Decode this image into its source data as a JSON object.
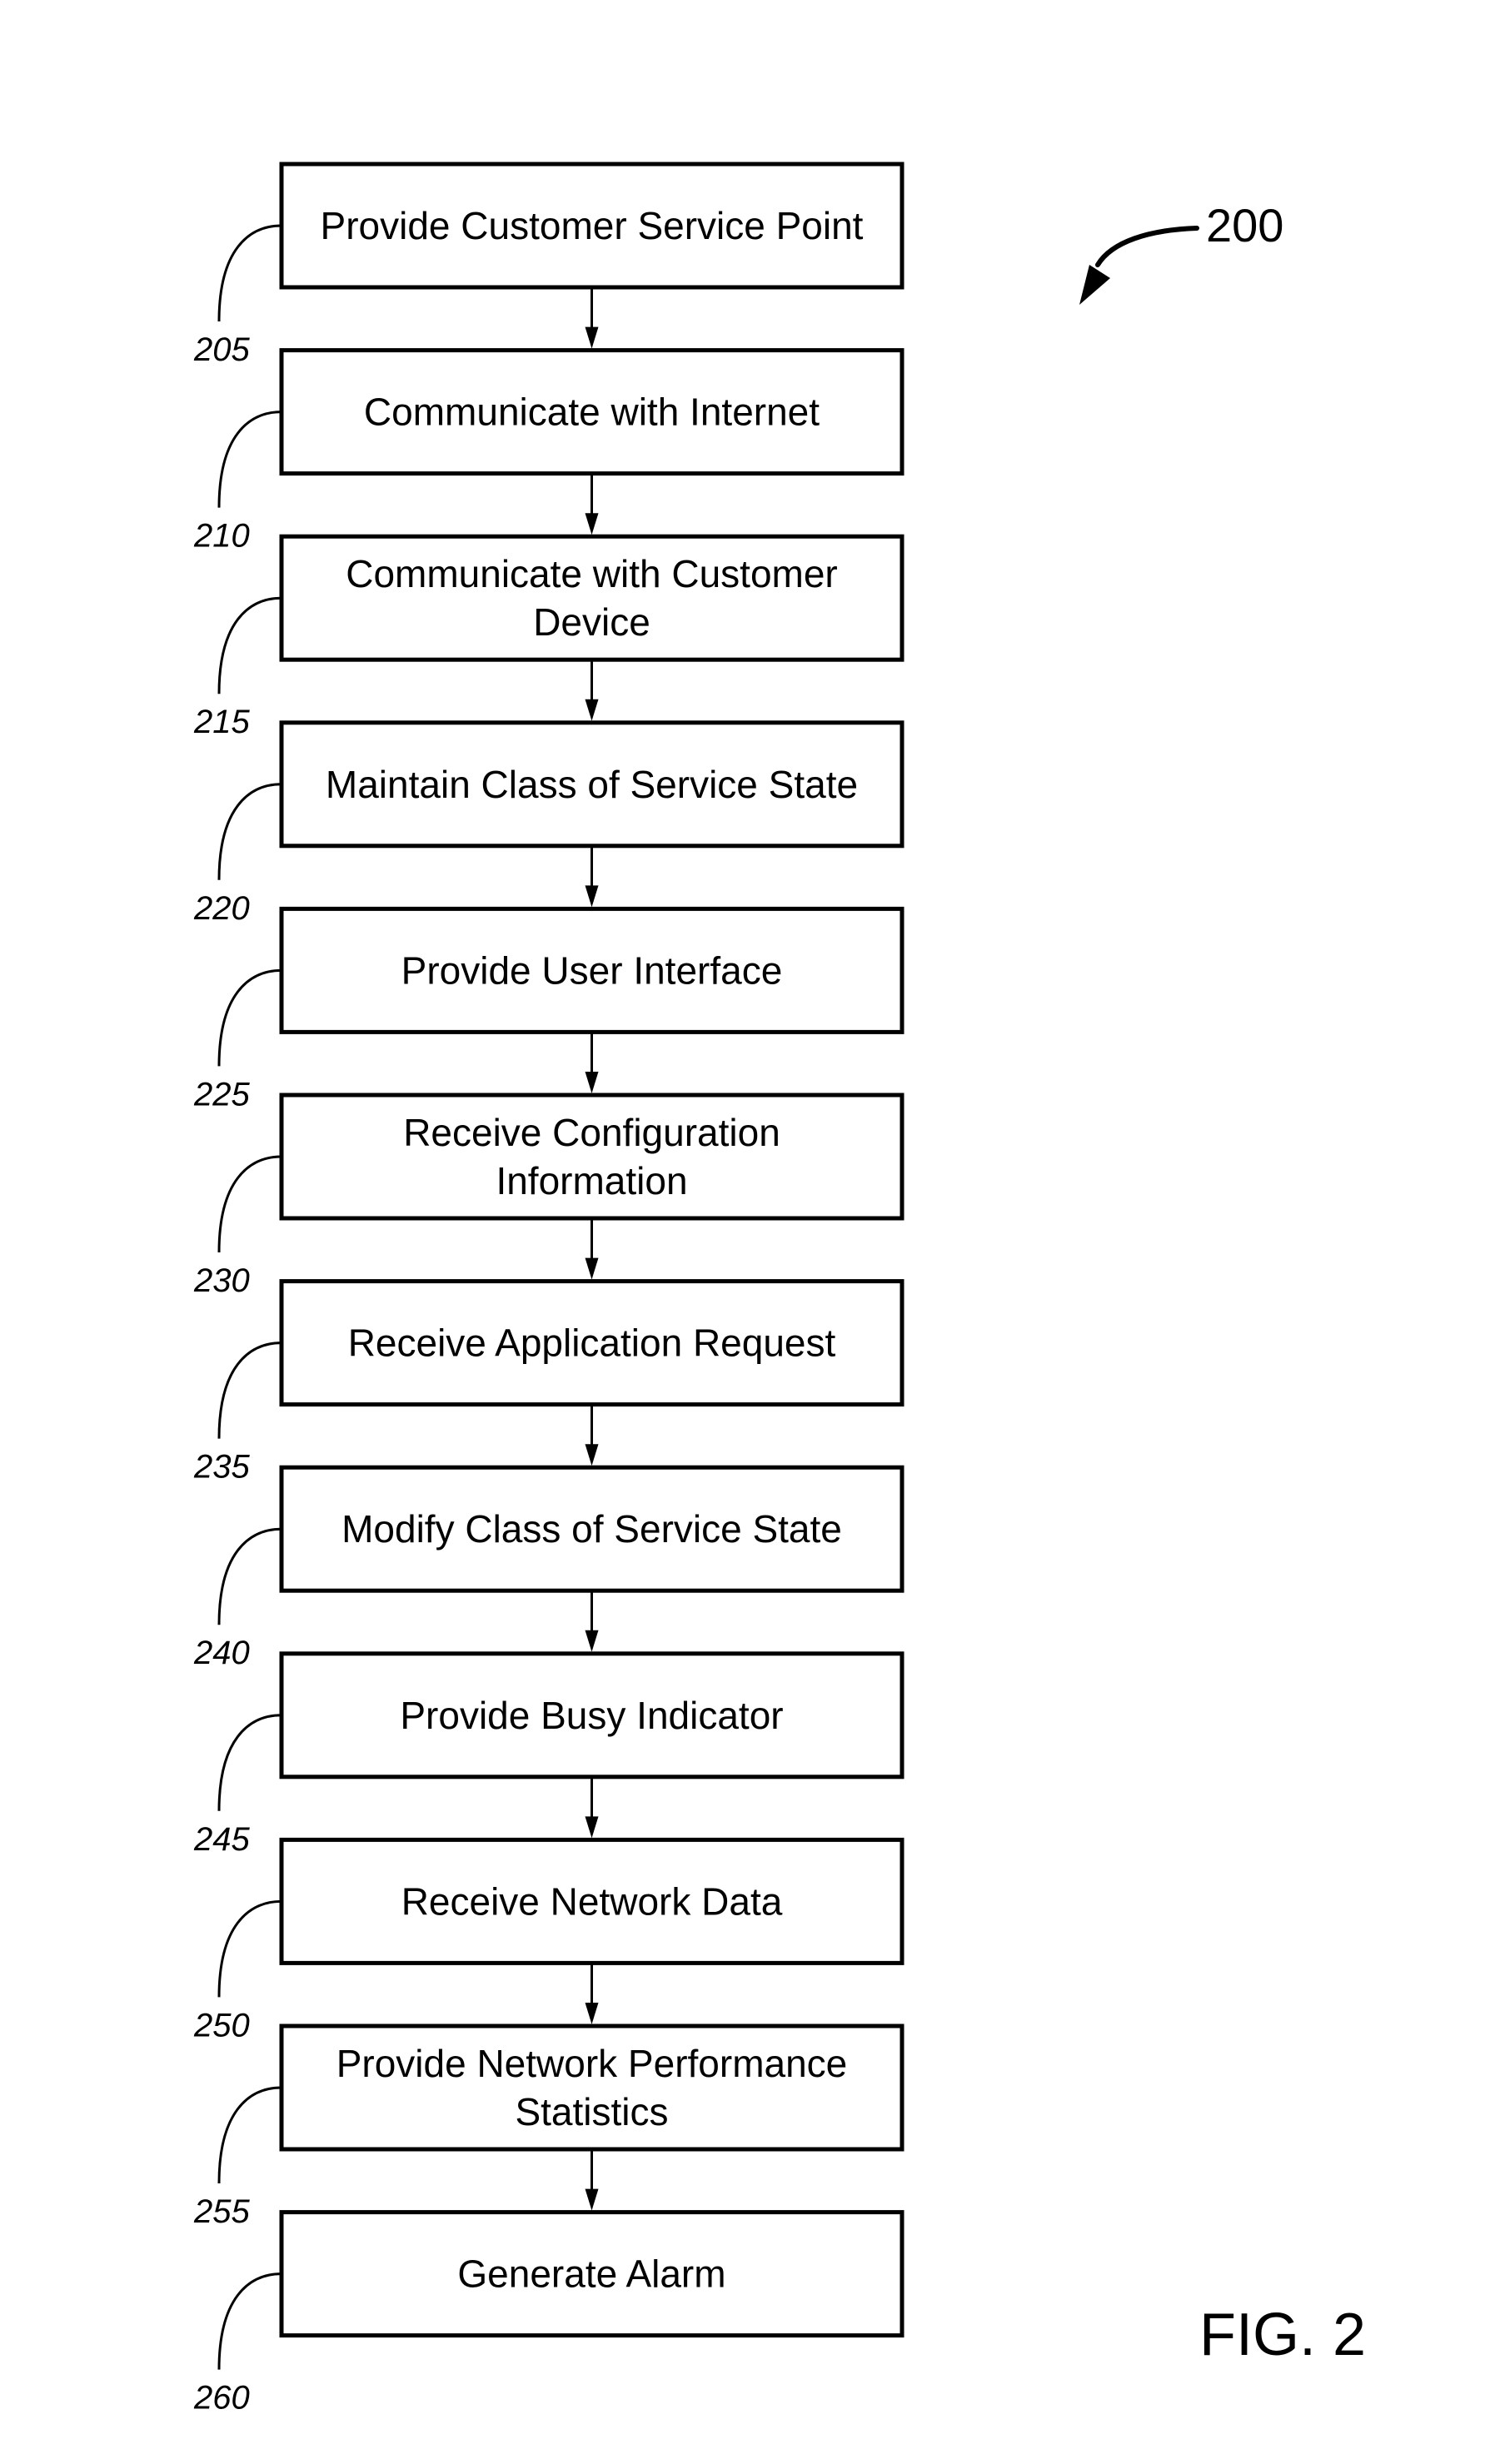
{
  "figure": {
    "reference_number": "200",
    "label": "FIG. 2"
  },
  "steps": [
    {
      "ref": "205",
      "lines": [
        "Provide Customer Service Point"
      ]
    },
    {
      "ref": "210",
      "lines": [
        "Communicate with Internet"
      ]
    },
    {
      "ref": "215",
      "lines": [
        "Communicate with Customer",
        "Device"
      ]
    },
    {
      "ref": "220",
      "lines": [
        "Maintain Class of Service State"
      ]
    },
    {
      "ref": "225",
      "lines": [
        "Provide User Interface"
      ]
    },
    {
      "ref": "230",
      "lines": [
        "Receive Configuration",
        "Information"
      ]
    },
    {
      "ref": "235",
      "lines": [
        "Receive Application Request"
      ]
    },
    {
      "ref": "240",
      "lines": [
        "Modify Class of Service State"
      ]
    },
    {
      "ref": "245",
      "lines": [
        "Provide Busy Indicator"
      ]
    },
    {
      "ref": "250",
      "lines": [
        "Receive Network Data"
      ]
    },
    {
      "ref": "255",
      "lines": [
        "Provide Network Performance",
        "Statistics"
      ]
    },
    {
      "ref": "260",
      "lines": [
        "Generate Alarm"
      ]
    }
  ]
}
